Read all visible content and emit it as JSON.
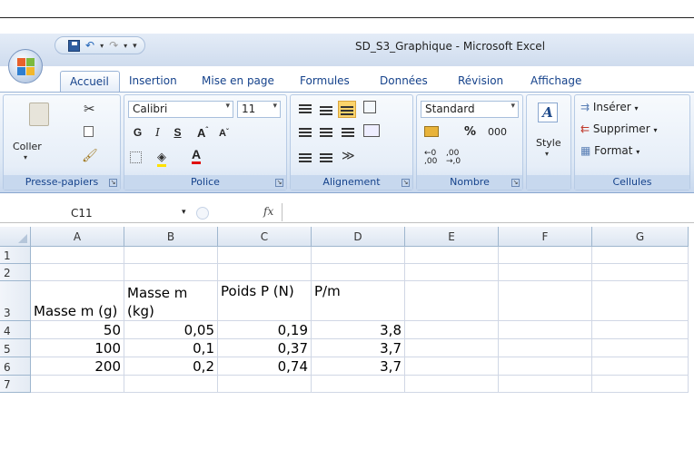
{
  "window_title": "SD_S3_Graphique - Microsoft Excel",
  "tabs": [
    {
      "label": "Accueil",
      "active": true
    },
    {
      "label": "Insertion"
    },
    {
      "label": "Mise en page"
    },
    {
      "label": "Formules"
    },
    {
      "label": "Données"
    },
    {
      "label": "Révision"
    },
    {
      "label": "Affichage"
    }
  ],
  "clipboard": {
    "paste_label": "Coller",
    "group": "Presse-papiers"
  },
  "font": {
    "name": "Calibri",
    "size": "11",
    "group": "Police",
    "bold": "G",
    "italic": "I",
    "underline": "S"
  },
  "alignment": {
    "group": "Alignement"
  },
  "number": {
    "format": "Standard",
    "percent": "%",
    "thousands": "000",
    "group": "Nombre"
  },
  "styles": {
    "label": "Style"
  },
  "cells": {
    "insert": "Insérer",
    "delete": "Supprimer",
    "format": "Format",
    "group": "Cellules"
  },
  "name_box": "C11",
  "fx": "fx",
  "columns": [
    "A",
    "B",
    "C",
    "D",
    "E",
    "F",
    "G"
  ],
  "rows": [
    {
      "num": "1",
      "cells": [
        "",
        "",
        "",
        "",
        "",
        "",
        ""
      ]
    },
    {
      "num": "2",
      "cells": [
        "",
        "",
        "",
        "",
        "",
        "",
        ""
      ]
    },
    {
      "num": "3",
      "cells": [
        "Masse m (g)",
        "Masse m (kg)",
        "Poids P (N)",
        "P/m",
        "",
        "",
        ""
      ]
    },
    {
      "num": "4",
      "cells": [
        "50",
        "0,05",
        "0,19",
        "3,8",
        "",
        "",
        ""
      ]
    },
    {
      "num": "5",
      "cells": [
        "100",
        "0,1",
        "0,37",
        "3,7",
        "",
        "",
        ""
      ]
    },
    {
      "num": "6",
      "cells": [
        "200",
        "0,2",
        "0,74",
        "3,7",
        "",
        "",
        ""
      ]
    },
    {
      "num": "7",
      "cells": [
        "",
        "",
        "",
        "",
        "",
        "",
        ""
      ]
    }
  ],
  "colors": {
    "ribbon": "#dde8f5",
    "accent": "#15428b"
  }
}
